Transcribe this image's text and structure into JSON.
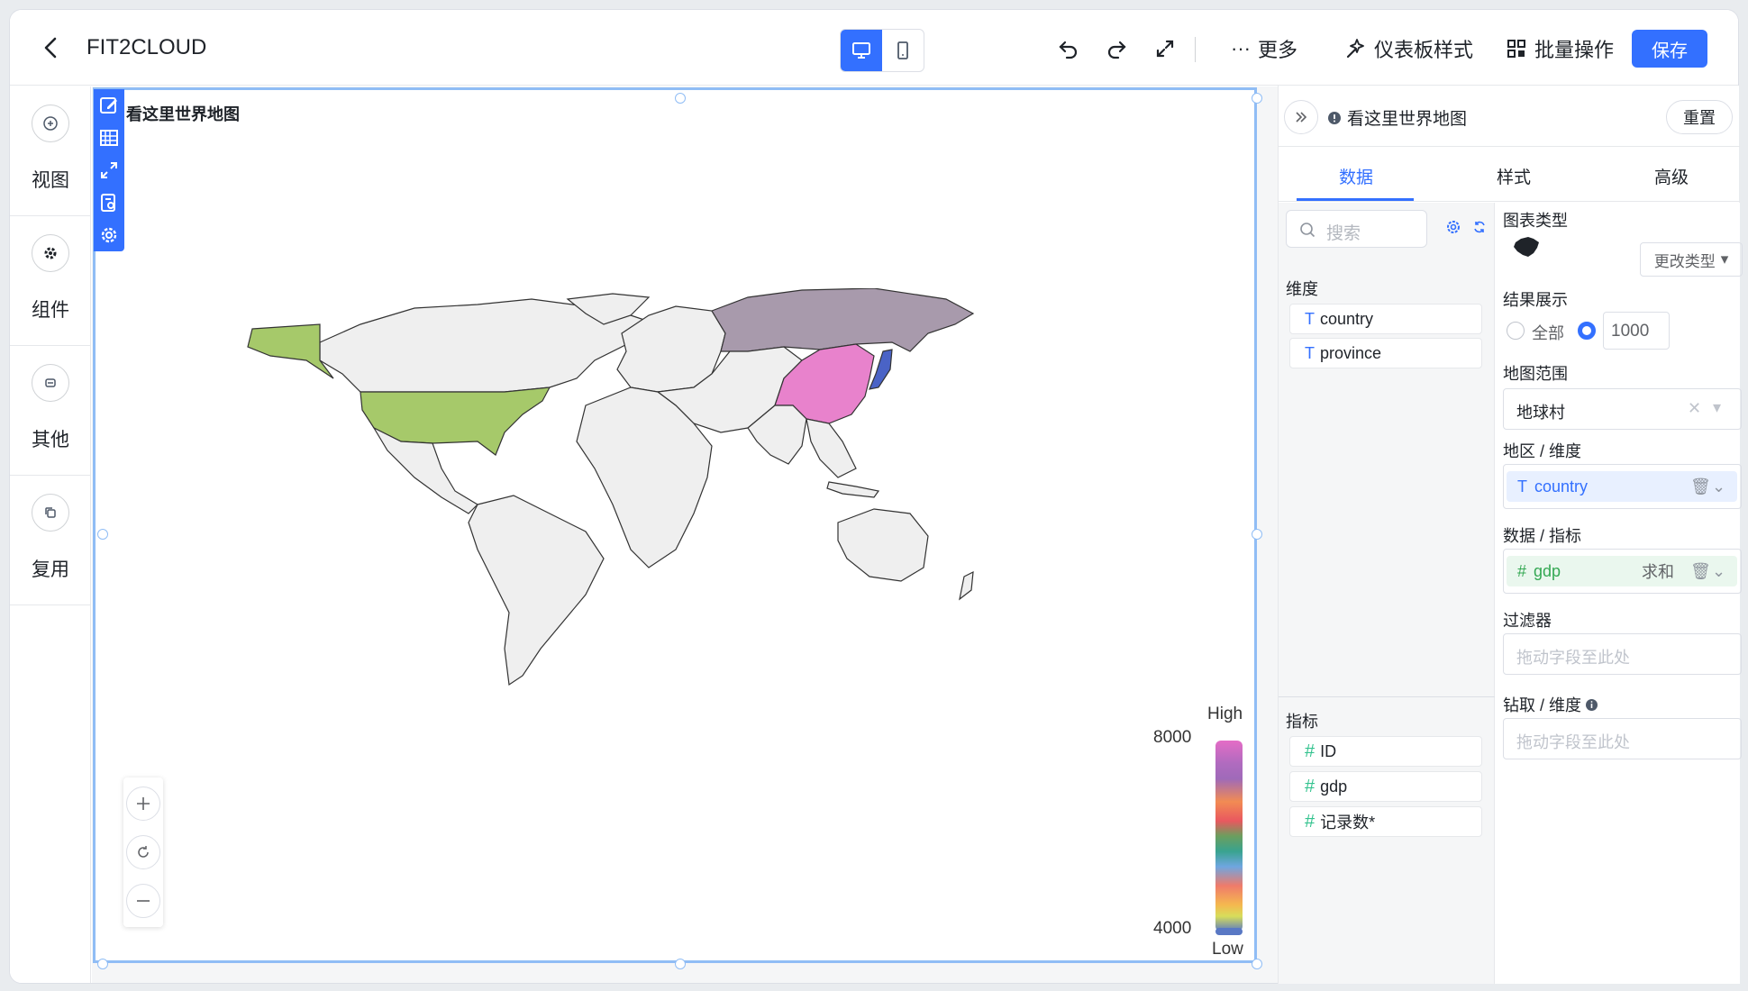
{
  "header": {
    "title": "FIT2CLOUD",
    "more_label": "更多",
    "dashboard_style_label": "仪表板样式",
    "batch_label": "批量操作",
    "save_label": "保存"
  },
  "sidebar": {
    "items": [
      {
        "label": "视图",
        "icon": "plus-circle-icon"
      },
      {
        "label": "组件",
        "icon": "gear-icon"
      },
      {
        "label": "其他",
        "icon": "other-icon"
      },
      {
        "label": "复用",
        "icon": "copy-icon"
      }
    ]
  },
  "chart": {
    "title": "看这里世界地图",
    "legend_high": "High",
    "legend_low": "Low",
    "legend_max": "8000",
    "legend_min": "4000",
    "highlighted": [
      {
        "country": "China",
        "color": "#e882cc"
      },
      {
        "country": "Russia",
        "color": "#a89aac"
      },
      {
        "country": "United States",
        "color": "#a6c96a"
      },
      {
        "country": "Japan",
        "color": "#4a63c6"
      }
    ],
    "base_color": "#efefef"
  },
  "panel": {
    "title": "看这里世界地图",
    "reset_label": "重置",
    "tabs": [
      "数据",
      "样式",
      "高级"
    ],
    "active_tab": "数据",
    "search_placeholder": "搜索",
    "dimension_label": "维度",
    "dimensions": [
      "country",
      "province"
    ],
    "metric_label": "指标",
    "metrics": [
      "ID",
      "gdp",
      "记录数*"
    ],
    "chart_type_label": "图表类型",
    "change_type_label": "更改类型",
    "result_label": "结果展示",
    "result_all": "全部",
    "result_count": "1000",
    "map_range_label": "地图范围",
    "map_range_value": "地球村",
    "area_dim_label": "地区 / 维度",
    "area_dim_value": "country",
    "data_metric_label": "数据 / 指标",
    "data_metric_value": "gdp",
    "data_metric_agg": "求和",
    "filter_label": "过滤器",
    "drag_placeholder": "拖动字段至此处",
    "drill_label": "钻取 / 维度"
  }
}
